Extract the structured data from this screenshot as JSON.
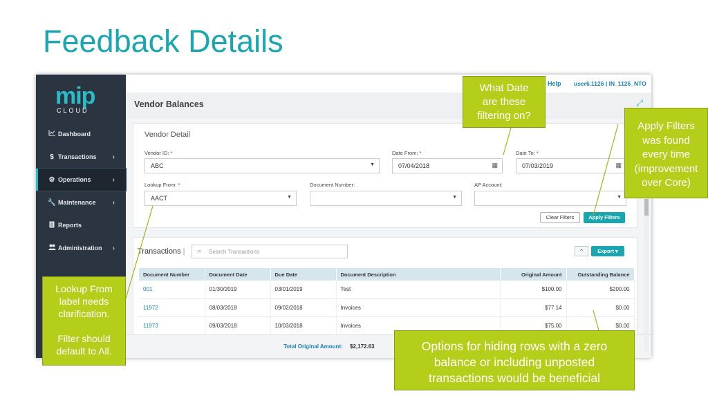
{
  "slide": {
    "title": "Feedback Details"
  },
  "app": {
    "logo_main": "mip",
    "logo_sub": "CLOUD",
    "topbar": {
      "help": "Help",
      "user": "user6.1126 | IN_1126_NTO"
    },
    "sidebar": [
      {
        "label": "Dashboard",
        "icon": "chart-icon",
        "chevron": false
      },
      {
        "label": "Transactions",
        "icon": "dollar-icon",
        "chevron": true
      },
      {
        "label": "Operations",
        "icon": "gears-icon",
        "chevron": true,
        "active": true
      },
      {
        "label": "Maintenance",
        "icon": "wrench-icon",
        "chevron": true
      },
      {
        "label": "Reports",
        "icon": "document-icon",
        "chevron": false
      },
      {
        "label": "Administration",
        "icon": "users-icon",
        "chevron": true
      }
    ],
    "page_title": "Vendor Balances",
    "detail": {
      "title": "Vendor Detail",
      "vendor_id_label": "Vendor ID:",
      "vendor_id_value": "ABC",
      "date_from_label": "Date From:",
      "date_from_value": "07/04/2018",
      "date_to_label": "Date To:",
      "date_to_value": "07/03/2019",
      "lookup_from_label": "Lookup From:",
      "lookup_from_value": "AACT",
      "document_number_label": "Document Number:",
      "ap_account_label": "AP Account:",
      "required_mark": "*",
      "clear_filters": "Clear Filters",
      "apply_filters": "Apply Filters"
    },
    "transactions": {
      "title": "Transactions",
      "divider": "|",
      "search_placeholder": "Search Transactions",
      "export_label": "Export",
      "collapse_label": "^",
      "columns": [
        "Document Number",
        "Document Date",
        "Due Date",
        "Document Description",
        "Original Amount",
        "Outstanding Balance"
      ],
      "rows": [
        [
          "001",
          "01/30/2019",
          "03/01/2019",
          "Test",
          "$100.00",
          "$200.00"
        ],
        [
          "11972",
          "08/03/2018",
          "09/02/2018",
          "Invoices",
          "$77.14",
          "$0.00"
        ],
        [
          "11973",
          "09/03/2018",
          "10/03/2018",
          "Invoices",
          "$75.00",
          "$0.00"
        ]
      ],
      "total_label": "Total Original Amount:",
      "total_value": "$2,172.63"
    }
  },
  "callouts": {
    "date": [
      "What Date",
      "are these",
      "filtering on?"
    ],
    "apply": [
      "Apply Filters",
      "was found",
      "every time",
      "(improvement",
      "over Core)"
    ],
    "lookup": [
      "Lookup From",
      "label needs",
      "clarification.",
      "",
      "Filter should",
      "default to All."
    ],
    "options": [
      "Options for hiding rows with a zero",
      "balance or including unposted",
      "transactions would be beneficial"
    ]
  },
  "colors": {
    "accent": "#1aa6b0",
    "callout": "#b5ce1a",
    "sidebar": "#2b3541"
  }
}
